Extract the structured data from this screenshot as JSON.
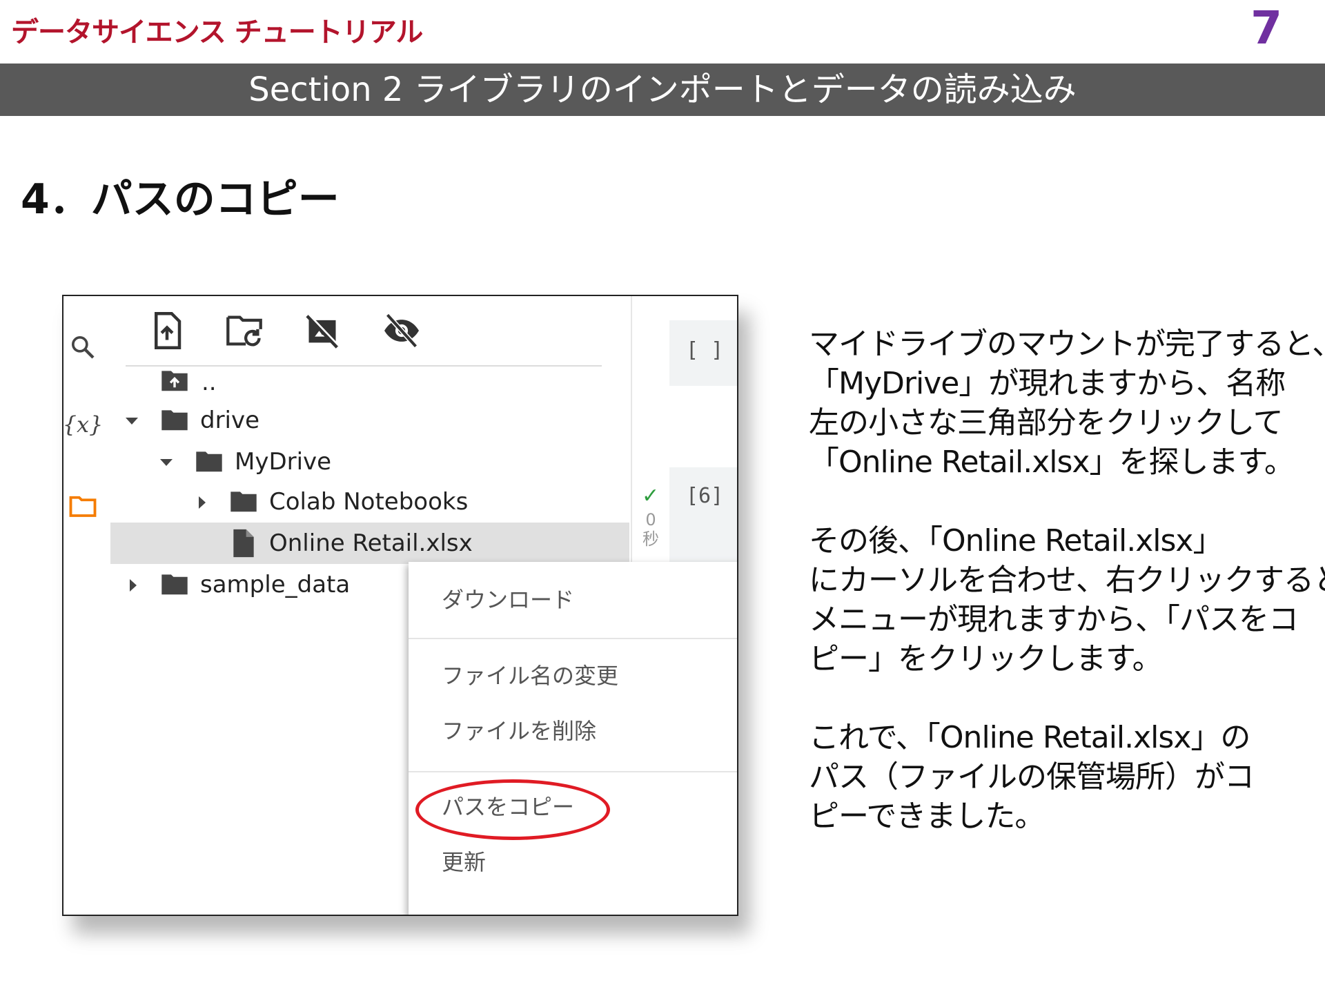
{
  "header": {
    "brand": "データサイエンス チュートリアル",
    "page_number": "7",
    "section": "Section 2 ライブラリのインポートとデータの読み込み"
  },
  "heading": "4．パスのコピー",
  "screenshot": {
    "tree": {
      "parent": "..",
      "drive": "drive",
      "mydrive": "MyDrive",
      "colab": "Colab Notebooks",
      "file": "Online Retail.xlsx",
      "sample": "sample_data"
    },
    "cells": {
      "empty_cell": "[ ]",
      "run_cell": "[6]",
      "exec_check": "✓",
      "exec_time": "0\n秒"
    },
    "context_menu": {
      "download": "ダウンロード",
      "rename": "ファイル名の変更",
      "delete": "ファイルを削除",
      "copy_path": "パスをコピー",
      "refresh": "更新"
    }
  },
  "explanation": {
    "p1": [
      "マイドライブのマウントが完了すると、",
      "「MyDrive」が現れますから、名称",
      "左の小さな三角部分をクリックして",
      "「Online Retail.xlsx」を探します。"
    ],
    "p2": [
      "その後、「Online Retail.xlsx」",
      "にカーソルを合わせ、右クリックすると",
      "メニューが現れますから、「パスをコ",
      "ピー」をクリックします。"
    ],
    "p3": [
      "これで、「Online Retail.xlsx」の",
      "パス（ファイルの保管場所）がコ",
      "ピーできました。"
    ]
  },
  "colors": {
    "brand": "#b3142c",
    "page_number": "#7030a0",
    "section_bar": "#595959",
    "highlight": "#e01b24",
    "files_icon": "#f57c00"
  }
}
